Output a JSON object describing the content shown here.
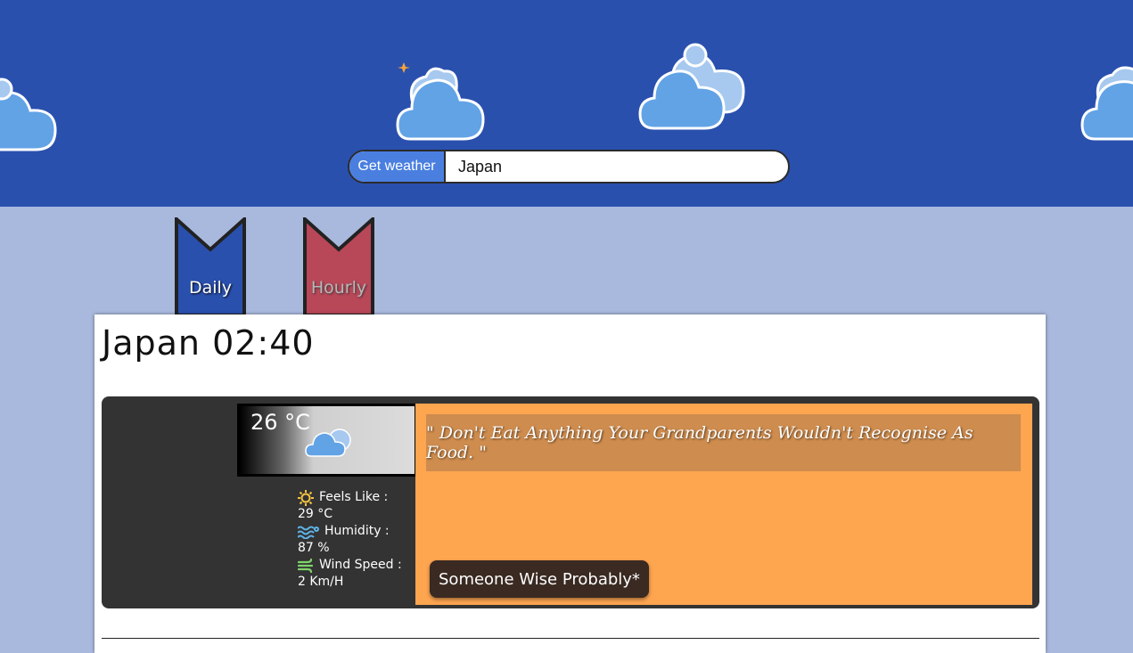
{
  "search": {
    "button_label": "Get weather",
    "value": "Japan"
  },
  "tabs": [
    {
      "label": "Daily",
      "color": "#2a50ae",
      "active": true
    },
    {
      "label": "Hourly",
      "color": "#b84758",
      "active": false
    }
  ],
  "location": {
    "title": "Japan 02:40"
  },
  "current": {
    "temperature": "26 °C",
    "feels_like_label": "Feels Like :",
    "feels_like_value": "29 °C",
    "humidity_label": "Humidity :",
    "humidity_value": "87 %",
    "wind_label": "Wind Speed :",
    "wind_value": "2 Km/H"
  },
  "quote": {
    "text": "\" Don't Eat Anything Your Grandparents Wouldn't Recognise As Food. \"",
    "author": "Someone Wise Probably*"
  },
  "colors": {
    "header": "#2a50ae",
    "background": "#a9b9dd",
    "quote_bg": "#fea550",
    "moon": "#f7a33b",
    "cloud": "#62a3e6"
  }
}
